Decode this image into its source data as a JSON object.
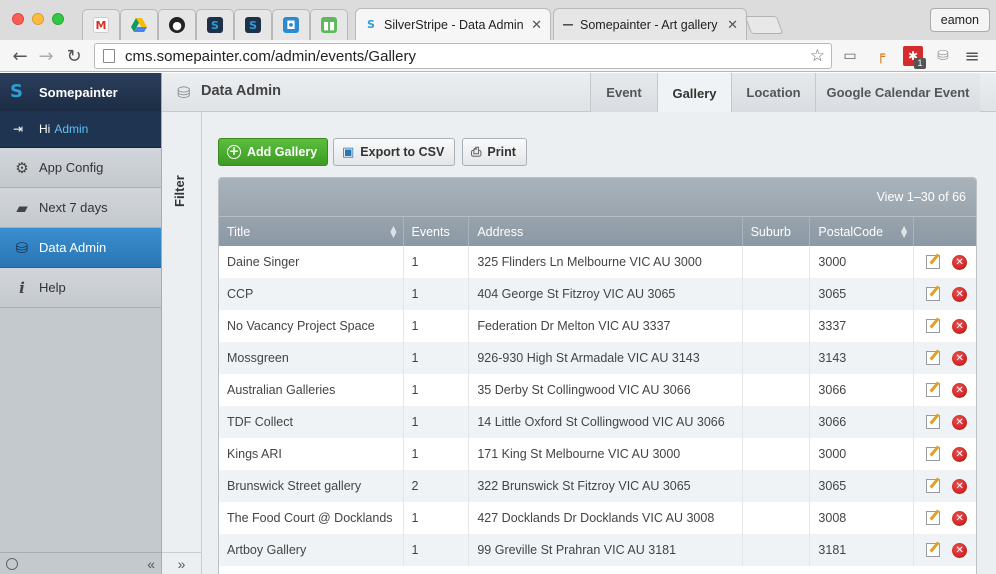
{
  "browser": {
    "tabs": [
      {
        "title": "SilverStripe - Data Admin",
        "active": true
      },
      {
        "title": "Somepainter - Art gallery o",
        "active": false
      }
    ],
    "pinned_tabs": [
      "gmail-icon",
      "google-drive-icon",
      "github-icon",
      "silverstripe-icon",
      "silverstripe-icon",
      "app-icon",
      "trello-icon"
    ],
    "profile": "eamon",
    "url": "cms.somepainter.com/admin/events/Gallery",
    "extension_badge": "1"
  },
  "sidebar": {
    "brand": "Somepainter",
    "greeting": "Hi",
    "user": "Admin",
    "items": [
      {
        "label": "App Config",
        "icon": "gear-icon"
      },
      {
        "label": "Next 7 days",
        "icon": "speech-bubble-icon"
      },
      {
        "label": "Data Admin",
        "icon": "database-icon",
        "active": true
      },
      {
        "label": "Help",
        "icon": "info-icon"
      }
    ],
    "collapse_symbol": "«"
  },
  "filter": {
    "label": "Filter",
    "expand_symbol": "»"
  },
  "header": {
    "title": "Data Admin",
    "tabs": [
      {
        "label": "Event"
      },
      {
        "label": "Gallery",
        "active": true
      },
      {
        "label": "Location"
      },
      {
        "label": "Google Calendar Event"
      }
    ]
  },
  "actions": {
    "add": "Add Gallery",
    "export": "Export to CSV",
    "print": "Print"
  },
  "grid": {
    "view_info": "View 1–30 of 66",
    "columns": [
      "Title",
      "Events",
      "Address",
      "Suburb",
      "PostalCode"
    ],
    "rows": [
      {
        "title": "Daine Singer",
        "events": "1",
        "address": "325 Flinders Ln Melbourne VIC AU 3000",
        "suburb": "",
        "postal": "3000"
      },
      {
        "title": "CCP",
        "events": "1",
        "address": "404 George St Fitzroy VIC AU 3065",
        "suburb": "",
        "postal": "3065"
      },
      {
        "title": "No Vacancy Project Space",
        "events": "1",
        "address": "Federation Dr Melton VIC AU 3337",
        "suburb": "",
        "postal": "3337"
      },
      {
        "title": "Mossgreen",
        "events": "1",
        "address": "926-930 High St Armadale VIC AU 3143",
        "suburb": "",
        "postal": "3143"
      },
      {
        "title": "Australian Galleries",
        "events": "1",
        "address": "35 Derby St Collingwood VIC AU 3066",
        "suburb": "",
        "postal": "3066"
      },
      {
        "title": "TDF Collect",
        "events": "1",
        "address": "14 Little Oxford St Collingwood VIC AU 3066",
        "suburb": "",
        "postal": "3066"
      },
      {
        "title": "Kings ARI",
        "events": "1",
        "address": "171 King St Melbourne VIC AU 3000",
        "suburb": "",
        "postal": "3000"
      },
      {
        "title": "Brunswick Street gallery",
        "events": "2",
        "address": "322 Brunswick St Fitzroy VIC AU 3065",
        "suburb": "",
        "postal": "3065"
      },
      {
        "title": "The Food Court @ Docklands",
        "events": "1",
        "address": "427 Docklands Dr Docklands VIC AU 3008",
        "suburb": "",
        "postal": "3008"
      },
      {
        "title": "Artboy Gallery",
        "events": "1",
        "address": "99 Greville St Prahran VIC AU 3181",
        "suburb": "",
        "postal": "3181"
      }
    ]
  },
  "colors": {
    "sidebar_dark": "#1f3451",
    "active_blue": "#2a75b3",
    "add_green": "#3d9b24",
    "delete_red": "#c41a1a"
  }
}
